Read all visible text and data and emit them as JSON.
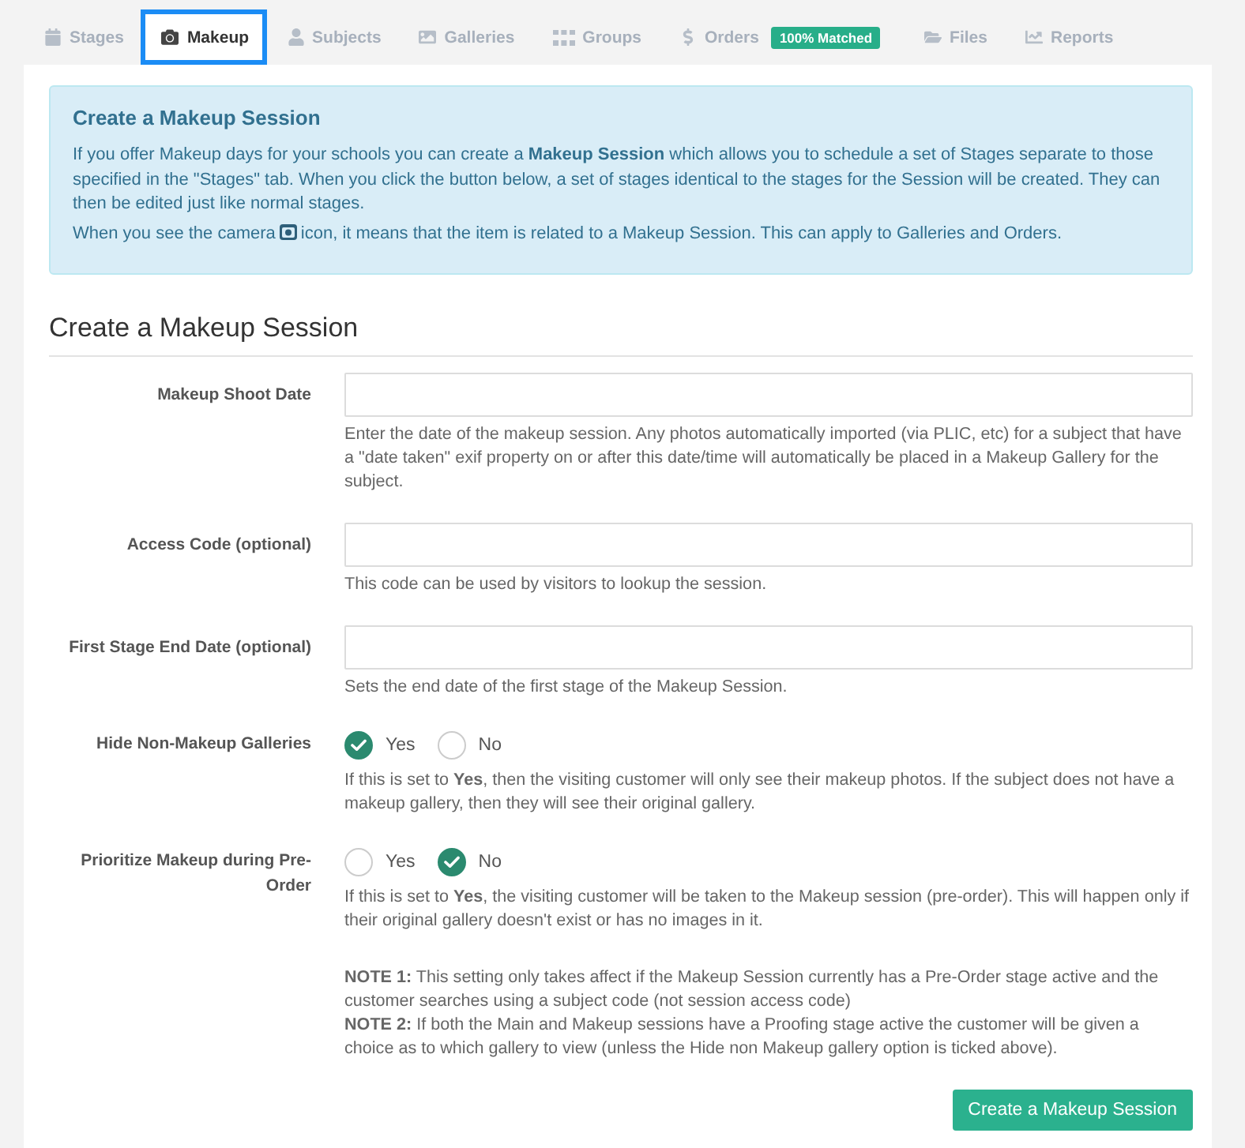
{
  "tabs": [
    {
      "label": "Stages",
      "selected": false
    },
    {
      "label": "Makeup",
      "selected": true
    },
    {
      "label": "Subjects",
      "selected": false
    },
    {
      "label": "Galleries",
      "selected": false
    },
    {
      "label": "Groups",
      "selected": false
    },
    {
      "label": "Orders",
      "selected": false,
      "badge": "100% Matched"
    },
    {
      "label": "Files",
      "selected": false
    },
    {
      "label": "Reports",
      "selected": false
    }
  ],
  "info": {
    "title": "Create a Makeup Session",
    "paragraph": "If you offer Makeup days for your schools you can create a **Makeup Session** which allows you to schedule a set of Stages separate to those specified in the \"Stages\" tab. When you click the button below, a set of stages identical to the stages for the Session will be created. They can then be edited just like normal stages.",
    "icon_note": {
      "before": "When you see the camera",
      "after": "icon, it means that the item is related to a Makeup Session. This can apply to Galleries and Orders."
    }
  },
  "form": {
    "heading": "Create a Makeup Session",
    "fields": [
      {
        "kind": "text",
        "label": "Makeup Shoot Date",
        "help": "Enter the date of the makeup session. Any photos automatically imported (via PLIC, etc) for a subject that have a \"date taken\" exif property on or after this date/time will automatically be placed in a Makeup Gallery for the subject."
      },
      {
        "kind": "text",
        "label": "Access Code (optional)",
        "help": "This code can be used by visitors to lookup the session."
      },
      {
        "kind": "text",
        "label": "First Stage End Date (optional)",
        "help": "Sets the end date of the first stage of the Makeup Session."
      },
      {
        "kind": "radio",
        "label": "Hide Non-Makeup Galleries",
        "options": [
          {
            "label": "Yes",
            "selected": true
          },
          {
            "label": "No",
            "selected": false
          }
        ],
        "help": "If this is set to **Yes**, then the visiting customer will only see their makeup photos. If the subject does not have a makeup gallery, then they will see their original gallery."
      },
      {
        "kind": "radio",
        "label": "Prioritize Makeup during Pre-Order",
        "options": [
          {
            "label": "Yes",
            "selected": false
          },
          {
            "label": "No",
            "selected": true
          }
        ],
        "help": "If this is set to **Yes**, the visiting customer will be taken to the Makeup session (pre-order). This will happen only if their original gallery doesn't exist or has no images in it.",
        "notes": [
          "**NOTE 1:** This setting only takes affect if the Makeup Session currently has a Pre-Order stage active and the customer searches using a subject code (not session access code)",
          "**NOTE 2:** If both the Main and Makeup sessions have a Proofing stage active the customer will be given a choice as to which gallery to view (unless the Hide non Makeup gallery option is ticked above)."
        ]
      }
    ],
    "submit": "Create a Makeup Session"
  }
}
